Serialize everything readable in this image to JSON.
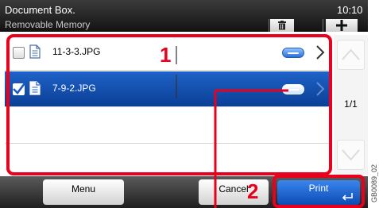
{
  "header": {
    "title": "Document Box.",
    "subtitle": "Removable Memory",
    "time": "10:10"
  },
  "files": [
    {
      "name": "11-3-3.JPG",
      "checked": false
    },
    {
      "name": "7-9-2.JPG",
      "checked": true
    }
  ],
  "pager": {
    "indicator": "1/1"
  },
  "bottom": {
    "menu_label": "Menu",
    "cancel_label": "Cancel",
    "print_label": "Print"
  },
  "callouts": {
    "one": "1",
    "two": "2"
  },
  "figure_code": "GB0089_02",
  "colors": {
    "selection": "#0a3f96",
    "print_button": "#1463d4",
    "callout": "#e8001c"
  },
  "icons": [
    "trash-icon",
    "plus-icon",
    "file-icon",
    "details-icon",
    "chevron-right-icon",
    "chevron-up-icon",
    "chevron-down-icon",
    "enter-icon"
  ]
}
